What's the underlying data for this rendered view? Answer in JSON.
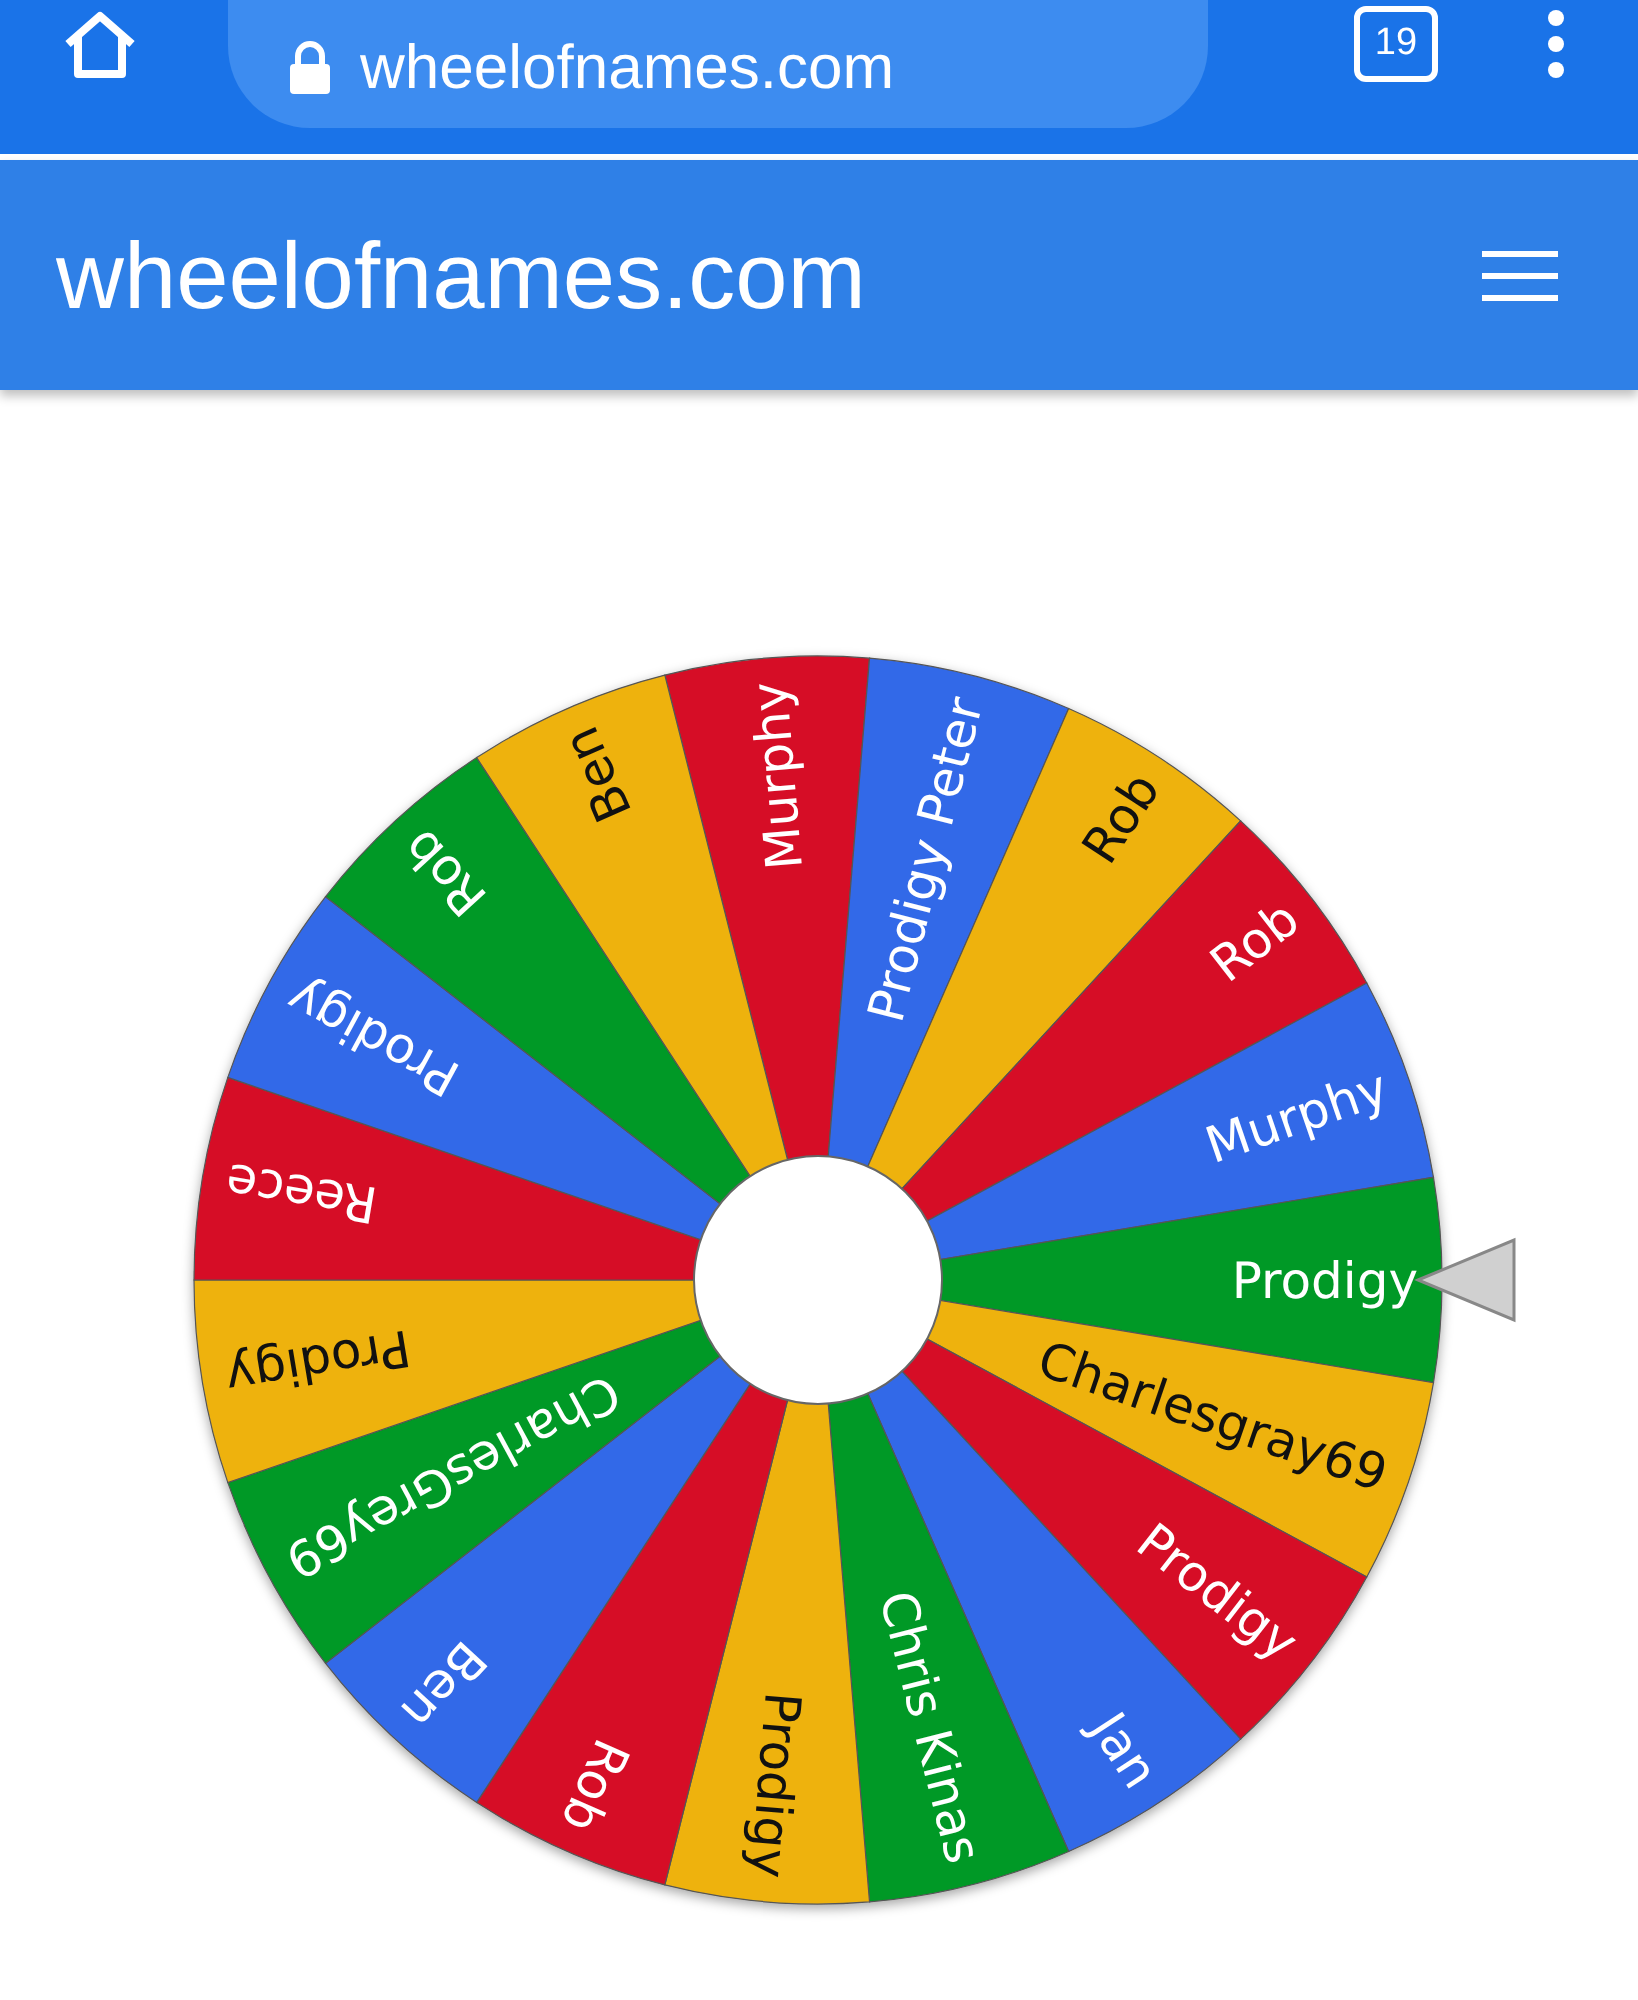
{
  "browser": {
    "url": "wheelofnames.com",
    "tab_count": "19"
  },
  "header": {
    "title": "wheelofnames.com"
  },
  "wheel": {
    "slices": [
      {
        "label": "Murphy",
        "color": "#d61126"
      },
      {
        "label": "Prodigy Peter",
        "color": "#3369e8"
      },
      {
        "label": "Rob",
        "color": "#eeb211"
      },
      {
        "label": "Rob",
        "color": "#d61126"
      },
      {
        "label": "Murphy",
        "color": "#3369e8"
      },
      {
        "label": "Prodigy",
        "color": "#009925"
      },
      {
        "label": "Charlesgray69",
        "color": "#eeb211"
      },
      {
        "label": "Prodigy",
        "color": "#d61126"
      },
      {
        "label": "Jan",
        "color": "#3369e8"
      },
      {
        "label": "Chris Kinas",
        "color": "#009925"
      },
      {
        "label": "Prodigy",
        "color": "#eeb211"
      },
      {
        "label": "Rob",
        "color": "#d61126"
      },
      {
        "label": "Ben",
        "color": "#3369e8"
      },
      {
        "label": "CharlesGrey69",
        "color": "#009925"
      },
      {
        "label": "Prodigy",
        "color": "#eeb211"
      },
      {
        "label": "Reece",
        "color": "#d61126"
      },
      {
        "label": "Prodigy",
        "color": "#3369e8"
      },
      {
        "label": "Rob",
        "color": "#009925"
      },
      {
        "label": "Ben",
        "color": "#eeb211"
      }
    ]
  }
}
